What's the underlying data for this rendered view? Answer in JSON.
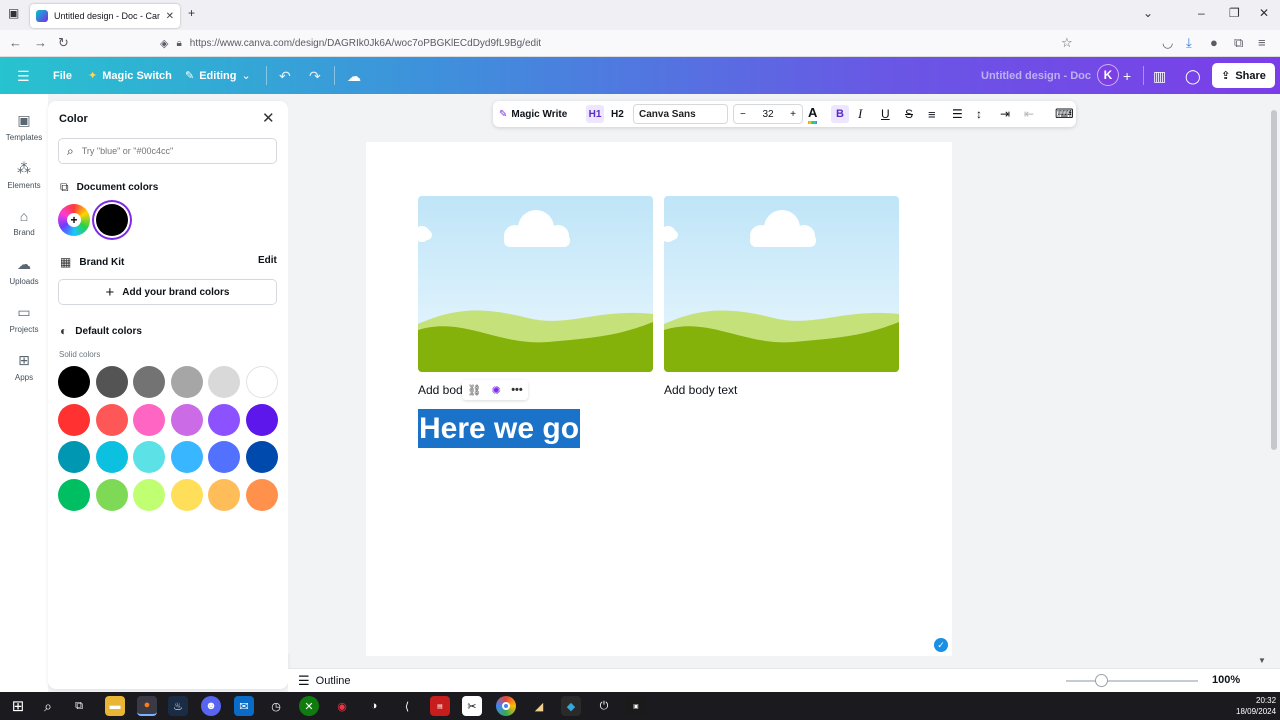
{
  "browser": {
    "tab_title": "Untitled design - Doc - Canva",
    "url": "https://www.canva.com/design/DAGRIk0Jk6A/woc7oPBGKlECdDyd9fL9Bg/edit"
  },
  "header": {
    "file_label": "File",
    "magic_switch_label": "Magic Switch",
    "editing_label": "Editing",
    "design_title": "Untitled design - Doc",
    "avatar_letter": "K",
    "share_label": "Share"
  },
  "rail": {
    "items": [
      {
        "label": "Templates"
      },
      {
        "label": "Elements"
      },
      {
        "label": "Brand"
      },
      {
        "label": "Uploads"
      },
      {
        "label": "Projects"
      },
      {
        "label": "Apps"
      }
    ]
  },
  "color_panel": {
    "title": "Color",
    "search_placeholder": "Try \"blue\" or \"#00c4cc\"",
    "document_colors_label": "Document colors",
    "brand_kit_label": "Brand Kit",
    "brand_kit_edit": "Edit",
    "add_brand_colors": "Add your brand colors",
    "default_colors_label": "Default colors",
    "solid_colors_label": "Solid colors",
    "document_colors": [
      "#000000"
    ],
    "solid_colors": [
      [
        "#000000",
        "#545454",
        "#737373",
        "#a6a6a6",
        "#d9d9d9",
        "#ffffff"
      ],
      [
        "#ff3131",
        "#ff5757",
        "#ff66c4",
        "#cb6ce6",
        "#8c52ff",
        "#5e17eb"
      ],
      [
        "#0097b2",
        "#0cc0df",
        "#5ce1e6",
        "#38b6ff",
        "#5271ff",
        "#004aad"
      ],
      [
        "#00bf63",
        "#7ed957",
        "#c1ff72",
        "#ffde59",
        "#ffbd59",
        "#ff914d"
      ]
    ]
  },
  "toolbar": {
    "magic_write_label": "Magic Write",
    "h1_label": "H1",
    "h2_label": "H2",
    "font_name": "Canva Sans",
    "font_size": "32",
    "minus": "−",
    "plus": "+"
  },
  "document": {
    "caption_left": "Add bod",
    "caption_right": "Add body text",
    "headline": "Here we go"
  },
  "bottom": {
    "outline_label": "Outline",
    "zoom": "100%",
    "zoom_fraction": 0.27
  },
  "taskbar": {
    "time": "20:32",
    "date": "18/09/2024"
  },
  "colors": {
    "accent": "#7d2ae8",
    "header_start": "#27c3cf",
    "header_end": "#7a3ee8",
    "selection": "#1a73c8"
  }
}
